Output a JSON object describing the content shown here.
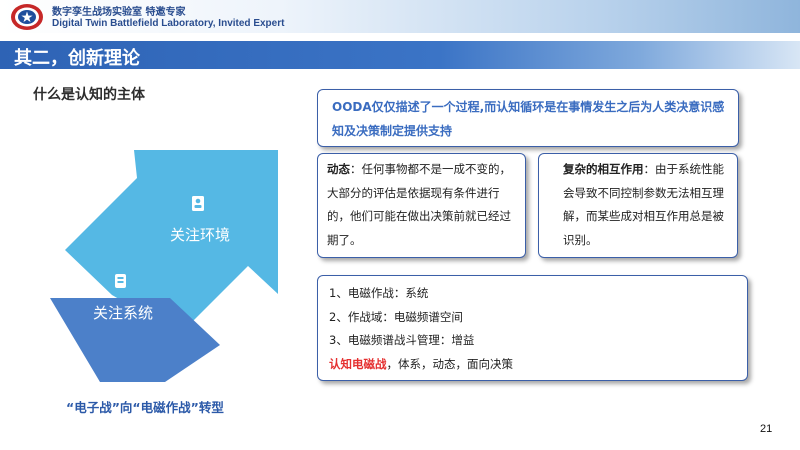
{
  "header": {
    "org_cn": "数字孪生战场实验室 特邀专家",
    "org_en": "Digital Twin Battlefield Laboratory, Invited Expert"
  },
  "section_title": "其二，创新理论",
  "subheading": "什么是认知的主体",
  "ooda_text": "OODA仅仅描述了一个过程,而认知循环是在事情发生之后为人类决意识感知及决策制定提供支持",
  "dynamic_box": {
    "label": "动态",
    "text": "：任何事物都不是一成不变的，大部分的评估是依据现有条件进行的，他们可能在做出决策前就已经过期了。"
  },
  "complex_box": {
    "label": "复杂的相互作用",
    "text": "：由于系统性能会导致不同控制参数无法相互理解，而某些成对相互作用总是被识别。"
  },
  "list_box": {
    "items": [
      "1、电磁作战：系统",
      "2、作战域：电磁频谱空间",
      "3、电磁频谱战斗管理：增益"
    ],
    "last_highlight": "认知电磁战",
    "last_rest": "，体系，动态，面向决策"
  },
  "diagram": {
    "upper_label": "关注环境",
    "lower_label": "关注系统",
    "colors": {
      "upper": "#55b8e4",
      "lower": "#4c80c9"
    }
  },
  "caption": "“电子战”向“电磁作战”转型",
  "page_number": "21"
}
